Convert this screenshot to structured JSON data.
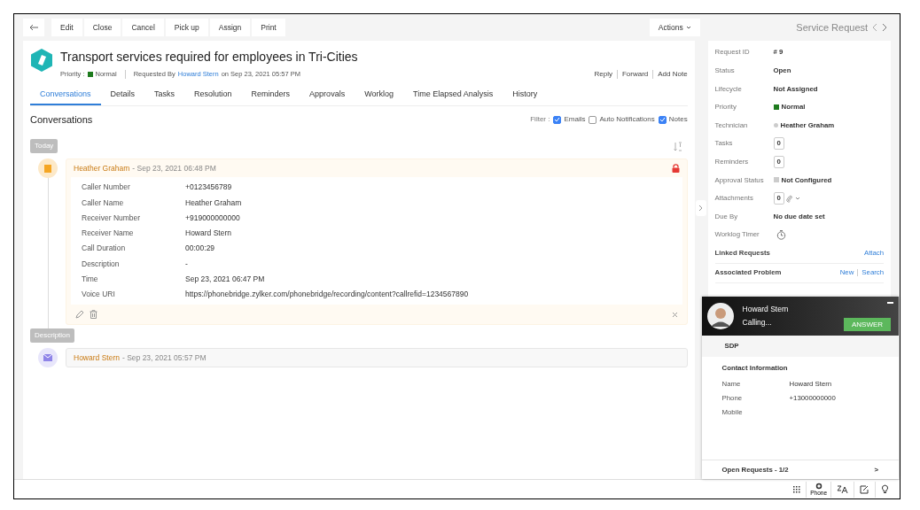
{
  "toolbar": {
    "buttons": [
      "Edit",
      "Close",
      "Cancel",
      "Pick up",
      "Assign",
      "Print"
    ],
    "actions": "Actions"
  },
  "header": {
    "title": "Transport services required for employees in Tri-Cities",
    "priority_label": "Priority :",
    "priority": {
      "label": "Normal",
      "color": "#1e7b1e"
    },
    "requested_by_label": "Requested By",
    "requester": "Howard Stern",
    "date": "on Sep 23, 2021 05:57 PM",
    "actions": [
      "Reply",
      "Forward",
      "Add Note"
    ]
  },
  "tabs": [
    {
      "label": "Conversations",
      "selected": true
    },
    {
      "label": "Details",
      "selected": false
    },
    {
      "label": "Tasks",
      "selected": false
    },
    {
      "label": "Resolution",
      "selected": false
    },
    {
      "label": "Reminders",
      "selected": false
    },
    {
      "label": "Approvals",
      "selected": false
    },
    {
      "label": "Worklog",
      "selected": false
    },
    {
      "label": "Time Elapsed Analysis",
      "selected": false
    },
    {
      "label": "History",
      "selected": false
    }
  ],
  "section_title": "Conversations",
  "filter": {
    "label": "Filter :",
    "options": [
      {
        "label": "Emails",
        "checked": true
      },
      {
        "label": "Auto Notifications",
        "checked": false
      },
      {
        "label": "Notes",
        "checked": true
      }
    ]
  },
  "timeline": [
    {
      "label": "Today",
      "entries": [
        {
          "kind": "note",
          "author": "Heather Graham",
          "date": "- Sep 23, 2021 06:48 PM",
          "locked": true,
          "fields": [
            {
              "label": "Caller Number",
              "value": "+0123456789"
            },
            {
              "label": "Caller Name",
              "value": "Heather Graham"
            },
            {
              "label": "Receiver Number",
              "value": "+919000000000"
            },
            {
              "label": "Receiver Name",
              "value": "Howard Stern"
            },
            {
              "label": "Call Duration",
              "value": "00:00:29"
            },
            {
              "label": "Description",
              "value": "-"
            },
            {
              "label": "Time",
              "value": "Sep 23, 2021 06:47 PM"
            },
            {
              "label": "Voice URI",
              "value": "https://phonebridge.zylker.com/phonebridge/recording/content?callrefid=1234567890"
            }
          ]
        }
      ]
    },
    {
      "label": "Description",
      "entries": [
        {
          "kind": "email",
          "author": "Howard Stern",
          "date": "- Sep 23, 2021 05:57 PM",
          "locked": false
        }
      ]
    }
  ],
  "side_title": "Service Request",
  "properties": [
    {
      "kind": "text",
      "label": "Request ID",
      "value": "# 9"
    },
    {
      "kind": "text",
      "label": "Status",
      "value": "Open"
    },
    {
      "kind": "text",
      "label": "Lifecycle",
      "value": "Not Assigned"
    },
    {
      "kind": "square",
      "label": "Priority",
      "value": "Normal",
      "color": "#1e7b1e"
    },
    {
      "kind": "dot",
      "label": "Technician",
      "value": "Heather Graham",
      "color": "#cccccc"
    },
    {
      "kind": "count",
      "label": "Tasks",
      "value": "0"
    },
    {
      "kind": "count",
      "label": "Reminders",
      "value": "0"
    },
    {
      "kind": "square",
      "label": "Approval Status",
      "value": "Not Configured",
      "color": "#cccccc"
    },
    {
      "kind": "attachments",
      "label": "Attachments",
      "value": "0"
    },
    {
      "kind": "text",
      "label": "Due By",
      "value": "No due date set"
    },
    {
      "kind": "timer",
      "label": "Worklog Timer"
    }
  ],
  "linked": [
    {
      "label": "Linked Requests",
      "actions": [
        "Attach"
      ]
    },
    {
      "label": "Associated Problem",
      "actions": [
        "New",
        "Search"
      ]
    }
  ],
  "call": {
    "name": "Howard Stern",
    "status": "Calling...",
    "button": "ANSWER",
    "source": "SDP",
    "contact_title": "Contact Information",
    "fields": [
      {
        "label": "Name",
        "value": "Howard Stern"
      },
      {
        "label": "Phone",
        "value": "+13000000000"
      },
      {
        "label": "Mobile"
      }
    ],
    "open_requests": "Open Requests - 1/2",
    "open_arrow": ">"
  },
  "bottom_bar": {
    "phone_label": "Phone"
  }
}
